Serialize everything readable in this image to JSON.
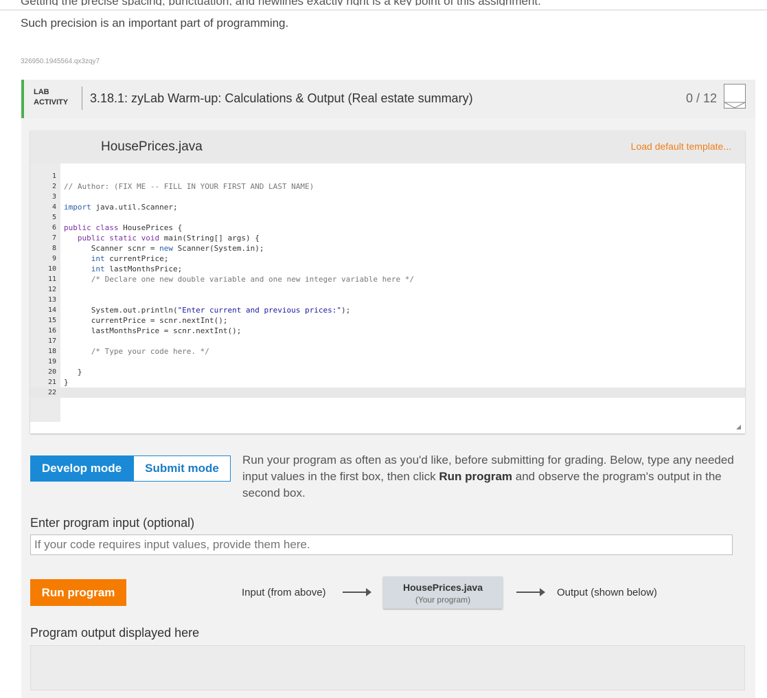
{
  "intro": {
    "cut_line": "Getting the precise spacing, punctuation, and newlines exactly right is a key point of this assignment.",
    "precision_text": "Such precision is an important part of programming.",
    "resource_id": "326950.1945564.qx3zqy7"
  },
  "activity": {
    "lab_label_line1": "LAB",
    "lab_label_line2": "ACTIVITY",
    "title": "3.18.1: zyLab Warm-up: Calculations & Output (Real estate summary)",
    "score": "0 / 12"
  },
  "editor": {
    "file_name": "HousePrices.java",
    "load_template": "Load default template...",
    "lines": [
      "",
      "// Author: (FIX ME -- FILL IN YOUR FIRST AND LAST NAME)",
      "",
      "import java.util.Scanner;",
      "",
      "public class HousePrices {",
      "   public static void main(String[] args) {",
      "      Scanner scnr = new Scanner(System.in);",
      "      int currentPrice;",
      "      int lastMonthsPrice;",
      "      /* Declare one new double variable and one new integer variable here */",
      "",
      "",
      "      System.out.println(\"Enter current and previous prices:\");",
      "      currentPrice = scnr.nextInt();",
      "      lastMonthsPrice = scnr.nextInt();",
      "",
      "      /* Type your code here. */",
      "",
      "   }",
      "}",
      ""
    ]
  },
  "modes": {
    "develop_label": "Develop mode",
    "submit_label": "Submit mode",
    "desc_part1": "Run your program as often as you'd like, before submitting for grading. Below, type any needed input values in the first box, then click ",
    "desc_bold": "Run program",
    "desc_part2": " and observe the program's output in the second box."
  },
  "input": {
    "label": "Enter program input (optional)",
    "placeholder": "If your code requires input values, provide them here."
  },
  "run": {
    "button_label": "Run program",
    "flow_input": "Input (from above)",
    "program_name": "HousePrices.java",
    "program_sub": "(Your program)",
    "flow_output": "Output (shown below)"
  },
  "output": {
    "label": "Program output displayed here"
  },
  "colors": {
    "accent_green": "#4caf50",
    "develop_blue": "#1a8ad6",
    "run_orange": "#f57c00",
    "link_orange": "#ef7f1a"
  }
}
